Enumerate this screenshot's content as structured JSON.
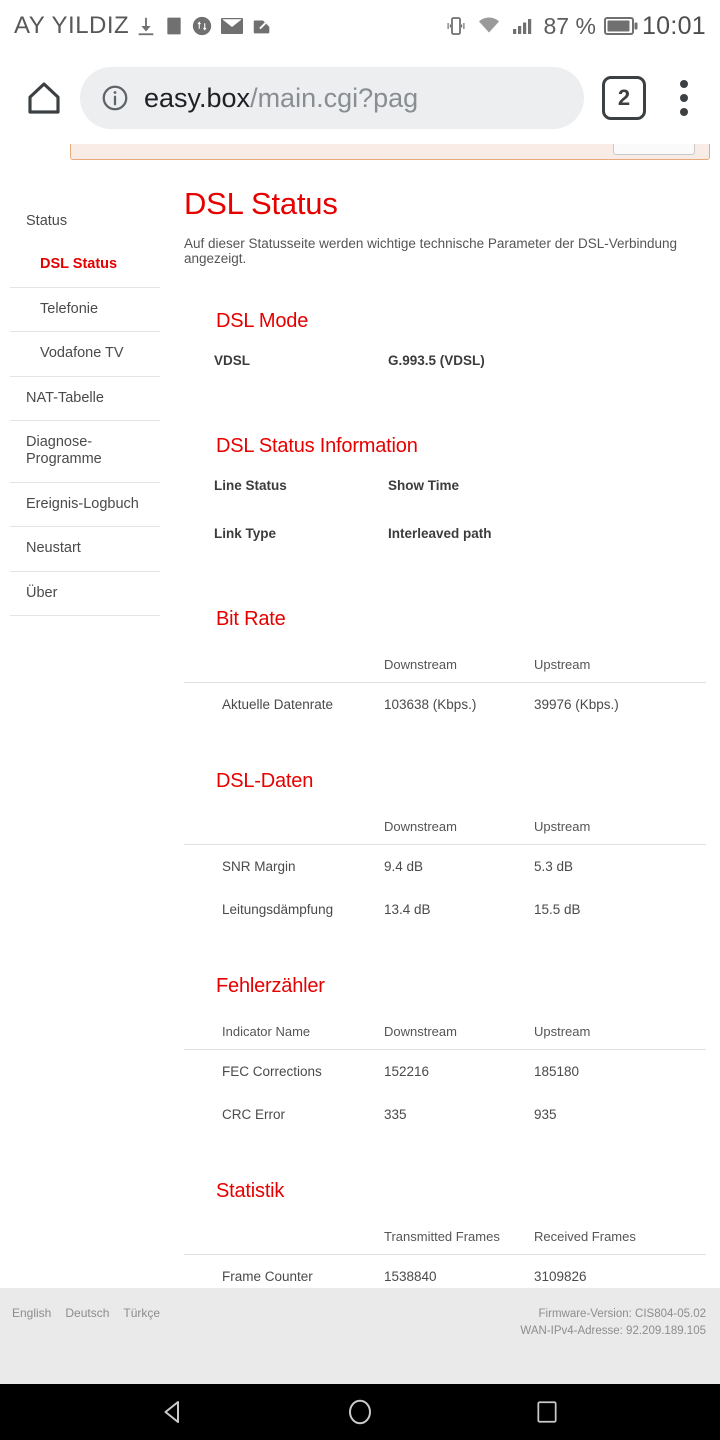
{
  "status_bar": {
    "carrier": "AY YILDIZ",
    "left_icons": [
      "download-icon",
      "square-icon",
      "data-transfer-icon",
      "mail-icon",
      "app-icon"
    ],
    "right_icons": [
      "vibrate-icon",
      "wifi-icon",
      "signal-icon",
      "battery-icon"
    ],
    "battery_percent": "87 %",
    "clock": "10:01"
  },
  "browser": {
    "home_label": "home-icon",
    "url_secure_part": "easy.box",
    "url_path_part": "/main.cgi?pag",
    "info_icon": "info-icon",
    "tab_count": "2",
    "menu_icon": "more-vertical-icon"
  },
  "sidebar": {
    "items": [
      {
        "label": "Status",
        "level": "top",
        "active": false
      },
      {
        "label": "DSL Status",
        "level": "sub",
        "active": true
      },
      {
        "label": "Telefonie",
        "level": "sub",
        "active": false
      },
      {
        "label": "Vodafone TV",
        "level": "sub",
        "active": false
      },
      {
        "label": "NAT-Tabelle",
        "level": "top",
        "active": false
      },
      {
        "label": "Diagnose-Programme",
        "level": "top",
        "active": false
      },
      {
        "label": "Ereignis-Logbuch",
        "level": "top",
        "active": false
      },
      {
        "label": "Neustart",
        "level": "top",
        "active": false
      },
      {
        "label": "Über",
        "level": "top",
        "active": false
      }
    ]
  },
  "main": {
    "title": "DSL Status",
    "description": "Auf dieser Statusseite werden wichtige technische Parameter der DSL-Verbindung angezeigt.",
    "sections": {
      "dsl_mode": {
        "title": "DSL Mode",
        "rows": [
          {
            "label": "VDSL",
            "value": "G.993.5 (VDSL)"
          }
        ]
      },
      "status_info": {
        "title": "DSL Status Information",
        "rows": [
          {
            "label": "Line Status",
            "value": "Show Time"
          },
          {
            "label": "Link Type",
            "value": "Interleaved path"
          }
        ]
      },
      "bit_rate": {
        "title": "Bit Rate",
        "headers": [
          "",
          "Downstream",
          "Upstream"
        ],
        "rows": [
          {
            "label": "Aktuelle Datenrate",
            "downstream": "103638 (Kbps.)",
            "upstream": "39976 (Kbps.)"
          }
        ]
      },
      "dsl_daten": {
        "title": "DSL-Daten",
        "headers": [
          "",
          "Downstream",
          "Upstream"
        ],
        "rows": [
          {
            "label": "SNR Margin",
            "downstream": "9.4 dB",
            "upstream": "5.3 dB"
          },
          {
            "label": "Leitungsdämpfung",
            "downstream": "13.4 dB",
            "upstream": "15.5 dB"
          }
        ]
      },
      "fehlerzaehler": {
        "title": "Fehlerzähler",
        "headers": [
          "Indicator Name",
          "Downstream",
          "Upstream"
        ],
        "rows": [
          {
            "label": "FEC Corrections",
            "downstream": "152216",
            "upstream": "185180"
          },
          {
            "label": "CRC Error",
            "downstream": "335",
            "upstream": "935"
          }
        ]
      },
      "statistik": {
        "title": "Statistik",
        "headers": [
          "",
          "Transmitted Frames",
          "Received Frames"
        ],
        "rows": [
          {
            "label": "Frame Counter",
            "downstream": "1538840",
            "upstream": "3109826"
          }
        ]
      }
    }
  },
  "footer": {
    "languages": [
      "English",
      "Deutsch",
      "Türkçe"
    ],
    "firmware_version": "Firmware-Version: CIS804-05.02",
    "wan_ip": "WAN-IPv4-Adresse: 92.209.189.105"
  },
  "nav_bar": {
    "back": "back-triangle-icon",
    "home": "home-circle-icon",
    "recents": "recents-square-icon"
  },
  "colors": {
    "brand_red": "#e60000",
    "text": "#4a4a4a",
    "footer_bg": "#eaeaea"
  }
}
